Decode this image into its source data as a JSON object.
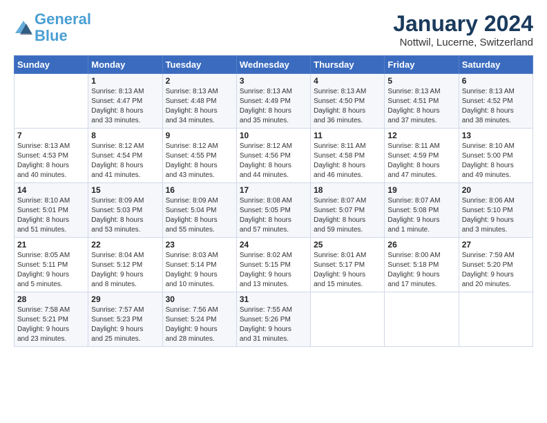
{
  "logo": {
    "line1": "General",
    "line2": "Blue"
  },
  "title": "January 2024",
  "subtitle": "Nottwil, Lucerne, Switzerland",
  "header": {
    "days": [
      "Sunday",
      "Monday",
      "Tuesday",
      "Wednesday",
      "Thursday",
      "Friday",
      "Saturday"
    ]
  },
  "weeks": [
    {
      "cells": [
        {
          "day": "",
          "info": ""
        },
        {
          "day": "1",
          "info": "Sunrise: 8:13 AM\nSunset: 4:47 PM\nDaylight: 8 hours\nand 33 minutes."
        },
        {
          "day": "2",
          "info": "Sunrise: 8:13 AM\nSunset: 4:48 PM\nDaylight: 8 hours\nand 34 minutes."
        },
        {
          "day": "3",
          "info": "Sunrise: 8:13 AM\nSunset: 4:49 PM\nDaylight: 8 hours\nand 35 minutes."
        },
        {
          "day": "4",
          "info": "Sunrise: 8:13 AM\nSunset: 4:50 PM\nDaylight: 8 hours\nand 36 minutes."
        },
        {
          "day": "5",
          "info": "Sunrise: 8:13 AM\nSunset: 4:51 PM\nDaylight: 8 hours\nand 37 minutes."
        },
        {
          "day": "6",
          "info": "Sunrise: 8:13 AM\nSunset: 4:52 PM\nDaylight: 8 hours\nand 38 minutes."
        }
      ]
    },
    {
      "cells": [
        {
          "day": "7",
          "info": "Sunrise: 8:13 AM\nSunset: 4:53 PM\nDaylight: 8 hours\nand 40 minutes."
        },
        {
          "day": "8",
          "info": "Sunrise: 8:12 AM\nSunset: 4:54 PM\nDaylight: 8 hours\nand 41 minutes."
        },
        {
          "day": "9",
          "info": "Sunrise: 8:12 AM\nSunset: 4:55 PM\nDaylight: 8 hours\nand 43 minutes."
        },
        {
          "day": "10",
          "info": "Sunrise: 8:12 AM\nSunset: 4:56 PM\nDaylight: 8 hours\nand 44 minutes."
        },
        {
          "day": "11",
          "info": "Sunrise: 8:11 AM\nSunset: 4:58 PM\nDaylight: 8 hours\nand 46 minutes."
        },
        {
          "day": "12",
          "info": "Sunrise: 8:11 AM\nSunset: 4:59 PM\nDaylight: 8 hours\nand 47 minutes."
        },
        {
          "day": "13",
          "info": "Sunrise: 8:10 AM\nSunset: 5:00 PM\nDaylight: 8 hours\nand 49 minutes."
        }
      ]
    },
    {
      "cells": [
        {
          "day": "14",
          "info": "Sunrise: 8:10 AM\nSunset: 5:01 PM\nDaylight: 8 hours\nand 51 minutes."
        },
        {
          "day": "15",
          "info": "Sunrise: 8:09 AM\nSunset: 5:03 PM\nDaylight: 8 hours\nand 53 minutes."
        },
        {
          "day": "16",
          "info": "Sunrise: 8:09 AM\nSunset: 5:04 PM\nDaylight: 8 hours\nand 55 minutes."
        },
        {
          "day": "17",
          "info": "Sunrise: 8:08 AM\nSunset: 5:05 PM\nDaylight: 8 hours\nand 57 minutes."
        },
        {
          "day": "18",
          "info": "Sunrise: 8:07 AM\nSunset: 5:07 PM\nDaylight: 8 hours\nand 59 minutes."
        },
        {
          "day": "19",
          "info": "Sunrise: 8:07 AM\nSunset: 5:08 PM\nDaylight: 9 hours\nand 1 minute."
        },
        {
          "day": "20",
          "info": "Sunrise: 8:06 AM\nSunset: 5:10 PM\nDaylight: 9 hours\nand 3 minutes."
        }
      ]
    },
    {
      "cells": [
        {
          "day": "21",
          "info": "Sunrise: 8:05 AM\nSunset: 5:11 PM\nDaylight: 9 hours\nand 5 minutes."
        },
        {
          "day": "22",
          "info": "Sunrise: 8:04 AM\nSunset: 5:12 PM\nDaylight: 9 hours\nand 8 minutes."
        },
        {
          "day": "23",
          "info": "Sunrise: 8:03 AM\nSunset: 5:14 PM\nDaylight: 9 hours\nand 10 minutes."
        },
        {
          "day": "24",
          "info": "Sunrise: 8:02 AM\nSunset: 5:15 PM\nDaylight: 9 hours\nand 13 minutes."
        },
        {
          "day": "25",
          "info": "Sunrise: 8:01 AM\nSunset: 5:17 PM\nDaylight: 9 hours\nand 15 minutes."
        },
        {
          "day": "26",
          "info": "Sunrise: 8:00 AM\nSunset: 5:18 PM\nDaylight: 9 hours\nand 17 minutes."
        },
        {
          "day": "27",
          "info": "Sunrise: 7:59 AM\nSunset: 5:20 PM\nDaylight: 9 hours\nand 20 minutes."
        }
      ]
    },
    {
      "cells": [
        {
          "day": "28",
          "info": "Sunrise: 7:58 AM\nSunset: 5:21 PM\nDaylight: 9 hours\nand 23 minutes."
        },
        {
          "day": "29",
          "info": "Sunrise: 7:57 AM\nSunset: 5:23 PM\nDaylight: 9 hours\nand 25 minutes."
        },
        {
          "day": "30",
          "info": "Sunrise: 7:56 AM\nSunset: 5:24 PM\nDaylight: 9 hours\nand 28 minutes."
        },
        {
          "day": "31",
          "info": "Sunrise: 7:55 AM\nSunset: 5:26 PM\nDaylight: 9 hours\nand 31 minutes."
        },
        {
          "day": "",
          "info": ""
        },
        {
          "day": "",
          "info": ""
        },
        {
          "day": "",
          "info": ""
        }
      ]
    }
  ]
}
